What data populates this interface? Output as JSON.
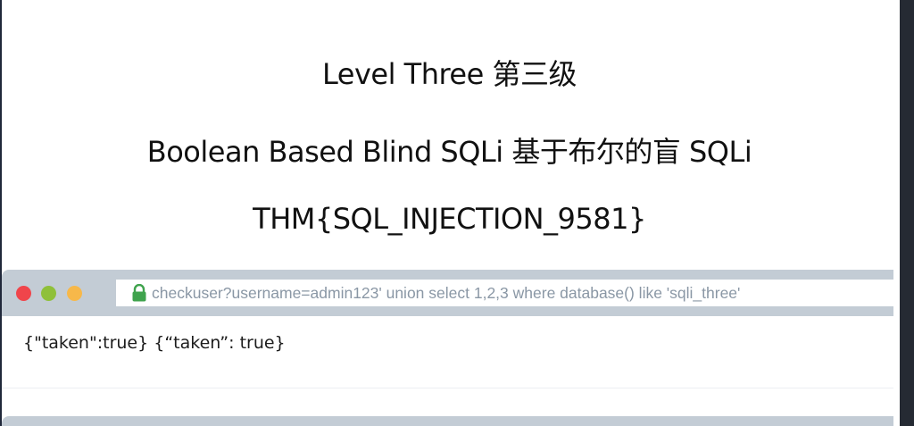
{
  "headings": {
    "level": "Level Three  第三级",
    "type": "Boolean Based Blind SQLi  基于布尔的盲 SQLi",
    "flag": "THM{SQL_INJECTION_9581}"
  },
  "browser": {
    "address_url": "checkuser?username=admin123' union select 1,2,3 where database() like 'sqli_three'",
    "response_text": "{\"taken\":true} {“taken”: true}",
    "colors": {
      "toolbar": "#c3ccd5",
      "close_dot": "#f0454b",
      "minimize_dot": "#8fc03a",
      "maximize_dot": "#f7b84a",
      "lock": "#3fa34d"
    }
  }
}
